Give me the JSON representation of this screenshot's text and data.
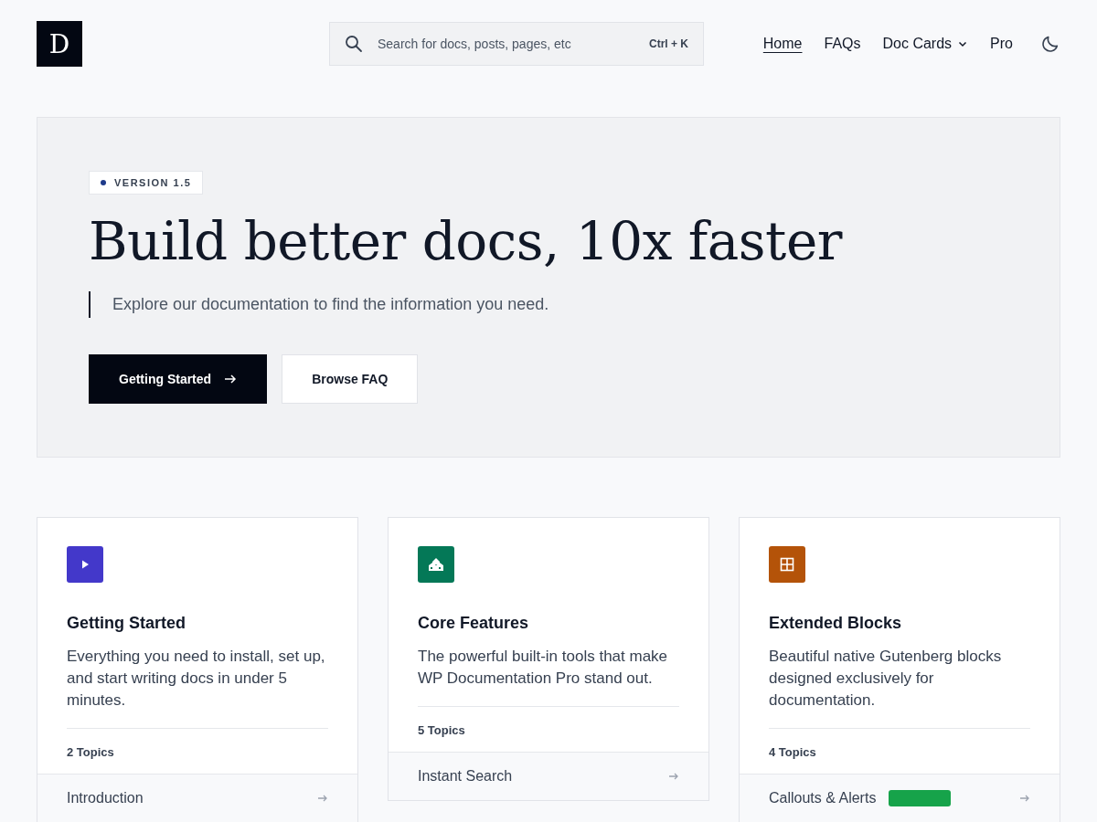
{
  "header": {
    "logo": "D",
    "search": {
      "placeholder": "Search for docs, posts, pages, etc",
      "shortcut": "Ctrl + K"
    },
    "nav": [
      {
        "label": "Home",
        "selected": true,
        "dropdown": false
      },
      {
        "label": "FAQs",
        "selected": false,
        "dropdown": false
      },
      {
        "label": "Doc Cards",
        "selected": false,
        "dropdown": true
      },
      {
        "label": "Pro",
        "selected": false,
        "dropdown": false
      }
    ]
  },
  "hero": {
    "badge": "VERSION 1.5",
    "title": "Build better docs, 10x faster",
    "subtitle": "Explore our documentation to find the information you need.",
    "buttons": [
      {
        "label": "Getting Started",
        "kind": "primary"
      },
      {
        "label": "Browse FAQ",
        "kind": "secondary"
      }
    ]
  },
  "cards": [
    {
      "kind": "play",
      "color": "#4338ca",
      "title": "Getting Started",
      "description": "Everything you need to install, set up, and start writing docs in under 5 minutes.",
      "topics": "2 Topics",
      "links": [
        {
          "label": "Introduction",
          "badge": false
        }
      ]
    },
    {
      "kind": "houses",
      "color": "#047857",
      "title": "Core Features",
      "description": "The powerful built-in tools that make WP Documentation Pro stand out.",
      "topics": "5 Topics",
      "links": [
        {
          "label": "Instant Search",
          "badge": false
        }
      ]
    },
    {
      "kind": "grid",
      "color": "#b45309",
      "title": "Extended Blocks",
      "description": "Beautiful native Gutenberg blocks designed exclusively for documentation.",
      "topics": "4 Topics",
      "links": [
        {
          "label": "Callouts & Alerts",
          "badge": true
        }
      ]
    }
  ]
}
